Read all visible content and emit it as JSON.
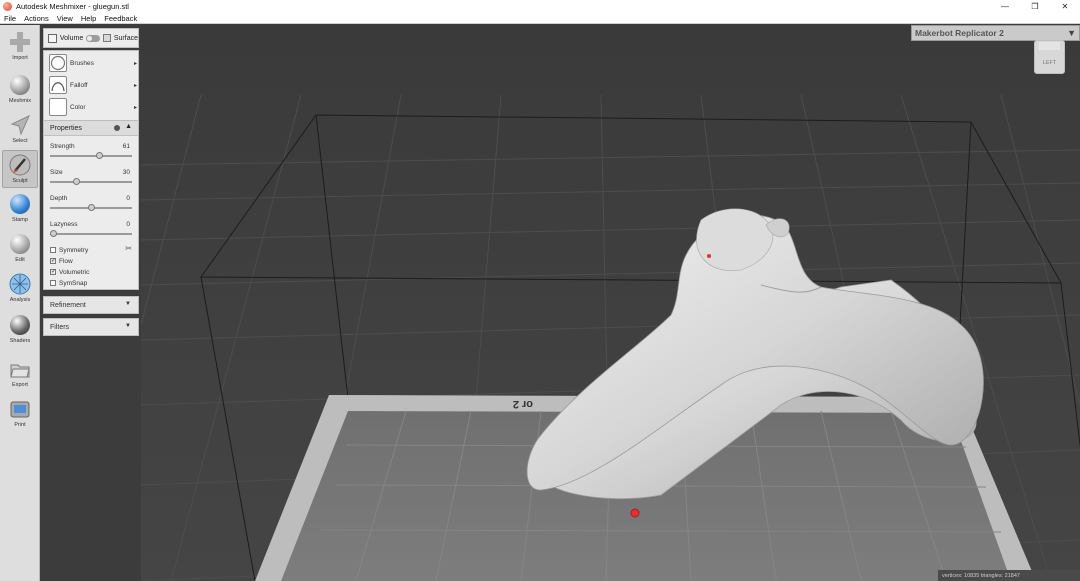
{
  "window": {
    "title": "Autodesk Meshmixer - gluegun.stl",
    "minimize": "—",
    "maximize": "❐",
    "close": "✕"
  },
  "menu": [
    "File",
    "Actions",
    "View",
    "Help",
    "Feedback"
  ],
  "tools": [
    {
      "label": "Import",
      "icon": "plus-icon"
    },
    {
      "label": "Meshmix",
      "icon": "meshmix-icon"
    },
    {
      "label": "Select",
      "icon": "select-arrow-icon"
    },
    {
      "label": "Sculpt",
      "icon": "sculpt-brush-icon",
      "active": true
    },
    {
      "label": "Stamp",
      "icon": "stamp-icon"
    },
    {
      "label": "Edit",
      "icon": "edit-icon"
    },
    {
      "label": "Analysis",
      "icon": "analysis-icon"
    },
    {
      "label": "Shaders",
      "icon": "shaders-icon"
    },
    {
      "label": "Export",
      "icon": "export-folder-icon"
    },
    {
      "label": "Print",
      "icon": "print-icon"
    }
  ],
  "mode": {
    "volume": "Volume",
    "surface": "Surface"
  },
  "brush_rows": {
    "brushes": "Brushes",
    "falloff": "Falloff",
    "color": "Color",
    "arrow": "▸"
  },
  "properties": {
    "title": "Properties",
    "strength": {
      "label": "Strength",
      "value": "61",
      "fraction": 0.61
    },
    "size": {
      "label": "Size",
      "value": "30",
      "fraction": 0.3
    },
    "depth": {
      "label": "Depth",
      "value": "0",
      "fraction": 0.5
    },
    "lazyness": {
      "label": "Lazyness",
      "value": "0",
      "fraction": 0.0
    },
    "symmetry": {
      "label": "Symmetry",
      "checked": false
    },
    "flow": {
      "label": "Flow",
      "checked": true
    },
    "volumetric": {
      "label": "Volumetric",
      "checked": true
    },
    "symsnap": {
      "label": "SymSnap",
      "checked": false
    }
  },
  "refinement": "Refinement",
  "filters": "Filters",
  "printer": "Makerbot Replicator 2",
  "bed_label": "or 2",
  "viewcube": "LEFT",
  "status": "vertices: 10835  triangles: 21847",
  "colors": {
    "accent": "#e63030",
    "toolbar": "#dedede",
    "viewport": "#3c3c3c"
  }
}
